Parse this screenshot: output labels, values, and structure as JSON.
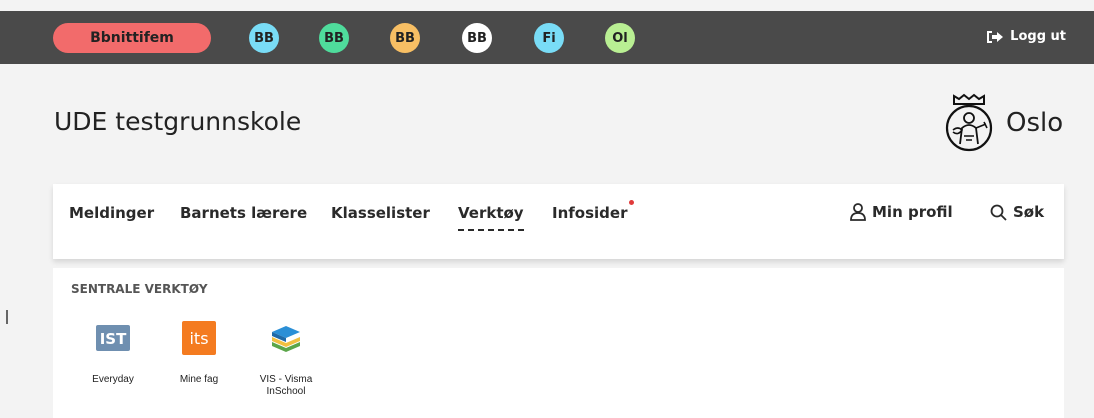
{
  "topbar": {
    "active_user": "Bbnittifem",
    "badges": [
      {
        "label": "BB",
        "color": "#79dcf6"
      },
      {
        "label": "BB",
        "color": "#4fdc9c"
      },
      {
        "label": "BB",
        "color": "#f8bf64"
      },
      {
        "label": "BB",
        "color": "#ffffff"
      },
      {
        "label": "Fi",
        "color": "#79dcf6"
      },
      {
        "label": "Ol",
        "color": "#b9ef93"
      }
    ],
    "logout_label": "Logg ut"
  },
  "header": {
    "school_name": "UDE testgrunnskole",
    "city": "Oslo"
  },
  "nav": {
    "items": [
      {
        "label": "Meldinger"
      },
      {
        "label": "Barnets lærere"
      },
      {
        "label": "Klasselister"
      },
      {
        "label": "Verktøy",
        "active": true
      },
      {
        "label": "Infosider",
        "notification": true
      }
    ],
    "profile_label": "Min profil",
    "search_label": "Søk"
  },
  "tools": {
    "section_title": "SENTRALE VERKTØY",
    "items": [
      {
        "label": "Everyday",
        "icon": "ist-logo-icon"
      },
      {
        "label": "Mine fag",
        "icon": "its-logo-icon"
      },
      {
        "label": "VIS - Visma InSchool",
        "icon": "books-icon"
      }
    ]
  }
}
